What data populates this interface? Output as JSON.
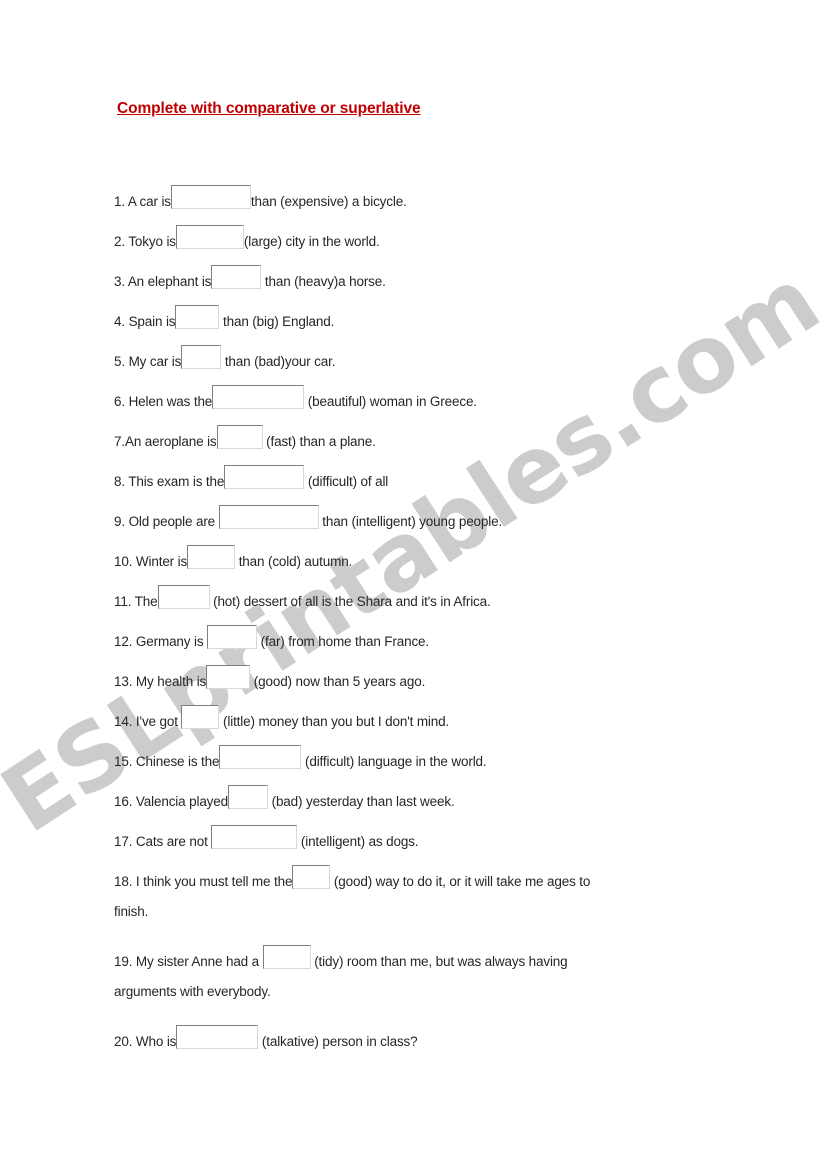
{
  "document": {
    "title": "Complete with comparative or superlative",
    "title_color": "#c00000",
    "watermark": "ESLprintables.com",
    "watermark_color": "#cccccc",
    "text_color": "#262626",
    "blank_border_color": "#7f7f7f"
  },
  "exercises": [
    {
      "number": "1.",
      "before": " A car is",
      "blank_width": 80,
      "after": "than (expensive) a bicycle.",
      "cue": "expensive",
      "wrap": ""
    },
    {
      "number": "2.",
      "before": " Tokyo is",
      "blank_width": 68,
      "after": "(large) city in the world.",
      "cue": "large",
      "wrap": ""
    },
    {
      "number": "3.",
      "before": " An elephant is",
      "blank_width": 50,
      "after": " than (heavy)a horse.",
      "cue": "heavy",
      "wrap": ""
    },
    {
      "number": "4.",
      "before": " Spain is",
      "blank_width": 44,
      "after": " than (big) England.",
      "cue": "big",
      "wrap": ""
    },
    {
      "number": "5.",
      "before": " My car is",
      "blank_width": 40,
      "after": " than (bad)your car.",
      "cue": "bad",
      "wrap": ""
    },
    {
      "number": "6.",
      "before": " Helen was the",
      "blank_width": 92,
      "after": " (beautiful) woman in Greece.",
      "cue": "beautiful",
      "wrap": ""
    },
    {
      "number": "7.",
      "before": "An aeroplane is",
      "blank_width": 46,
      "after": " (fast) than a plane.",
      "cue": "fast",
      "wrap": ""
    },
    {
      "number": "8.",
      "before": " This exam is the",
      "blank_width": 80,
      "after": " (difficult) of all",
      "cue": "difficult",
      "wrap": ""
    },
    {
      "number": "9.",
      "before": " Old people are ",
      "blank_width": 100,
      "after": " than (intelligent) young people.",
      "cue": "intelligent",
      "wrap": ""
    },
    {
      "number": "10.",
      "before": " Winter is",
      "blank_width": 48,
      "after": " than (cold) autumn.",
      "cue": "cold",
      "wrap": ""
    },
    {
      "number": "11.",
      "before": " The",
      "blank_width": 52,
      "after": " (hot) dessert of all is the Shara and it's in Africa.",
      "cue": "hot",
      "wrap": ""
    },
    {
      "number": "12.",
      "before": " Germany is ",
      "blank_width": 50,
      "after": " (far) from home than France.",
      "cue": "far",
      "wrap": ""
    },
    {
      "number": "13.",
      "before": " My health is",
      "blank_width": 44,
      "after": " (good) now than 5 years ago.",
      "cue": "good",
      "wrap": ""
    },
    {
      "number": "14.",
      "before": " I've got ",
      "blank_width": 38,
      "after": " (little) money than you but I don't mind.",
      "cue": "little",
      "wrap": ""
    },
    {
      "number": "15.",
      "before": " Chinese is the",
      "blank_width": 82,
      "after": " (difficult) language in the world.",
      "cue": "difficult",
      "wrap": ""
    },
    {
      "number": "16.",
      "before": " Valencia played",
      "blank_width": 40,
      "after": " (bad) yesterday than last week.",
      "cue": "bad",
      "wrap": ""
    },
    {
      "number": "17.",
      "before": " Cats are not ",
      "blank_width": 86,
      "after": " (intelligent) as dogs.",
      "cue": "intelligent",
      "wrap": ""
    },
    {
      "number": "18.",
      "before": " I think you must tell me the",
      "blank_width": 38,
      "after": " (good) way to do it, or it will take me ages to",
      "cue": "good",
      "wrap": "finish."
    },
    {
      "number": "19.",
      "before": " My sister Anne had a ",
      "blank_width": 48,
      "after": " (tidy) room than me, but was always having",
      "cue": "tidy",
      "wrap": "arguments with everybody."
    },
    {
      "number": "20.",
      "before": " Who is",
      "blank_width": 82,
      "after": " (talkative) person in class?",
      "cue": "talkative",
      "wrap": ""
    }
  ]
}
